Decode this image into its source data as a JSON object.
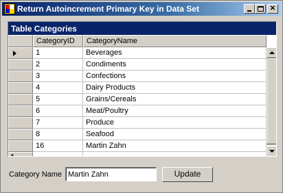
{
  "window": {
    "title": "Return Autoincrement Primary Key in Data Set",
    "icon": "app-icon"
  },
  "grid": {
    "caption": "Table Categories",
    "columns": [
      "CategoryID",
      "CategoryName"
    ],
    "rows": [
      {
        "id": "1",
        "name": "Beverages"
      },
      {
        "id": "2",
        "name": "Condiments"
      },
      {
        "id": "3",
        "name": "Confections"
      },
      {
        "id": "4",
        "name": "Dairy Products"
      },
      {
        "id": "5",
        "name": "Grains/Cereals"
      },
      {
        "id": "6",
        "name": "Meat/Poultry"
      },
      {
        "id": "7",
        "name": "Produce"
      },
      {
        "id": "8",
        "name": "Seafood"
      },
      {
        "id": "16",
        "name": "Martin Zahn"
      }
    ],
    "new_row_marker": "*"
  },
  "form": {
    "category_label": "Category Name",
    "category_value": "Martin Zahn",
    "update_label": "Update"
  },
  "colors": {
    "caption_bg": "#0a246a",
    "face": "#d4d0c8"
  }
}
